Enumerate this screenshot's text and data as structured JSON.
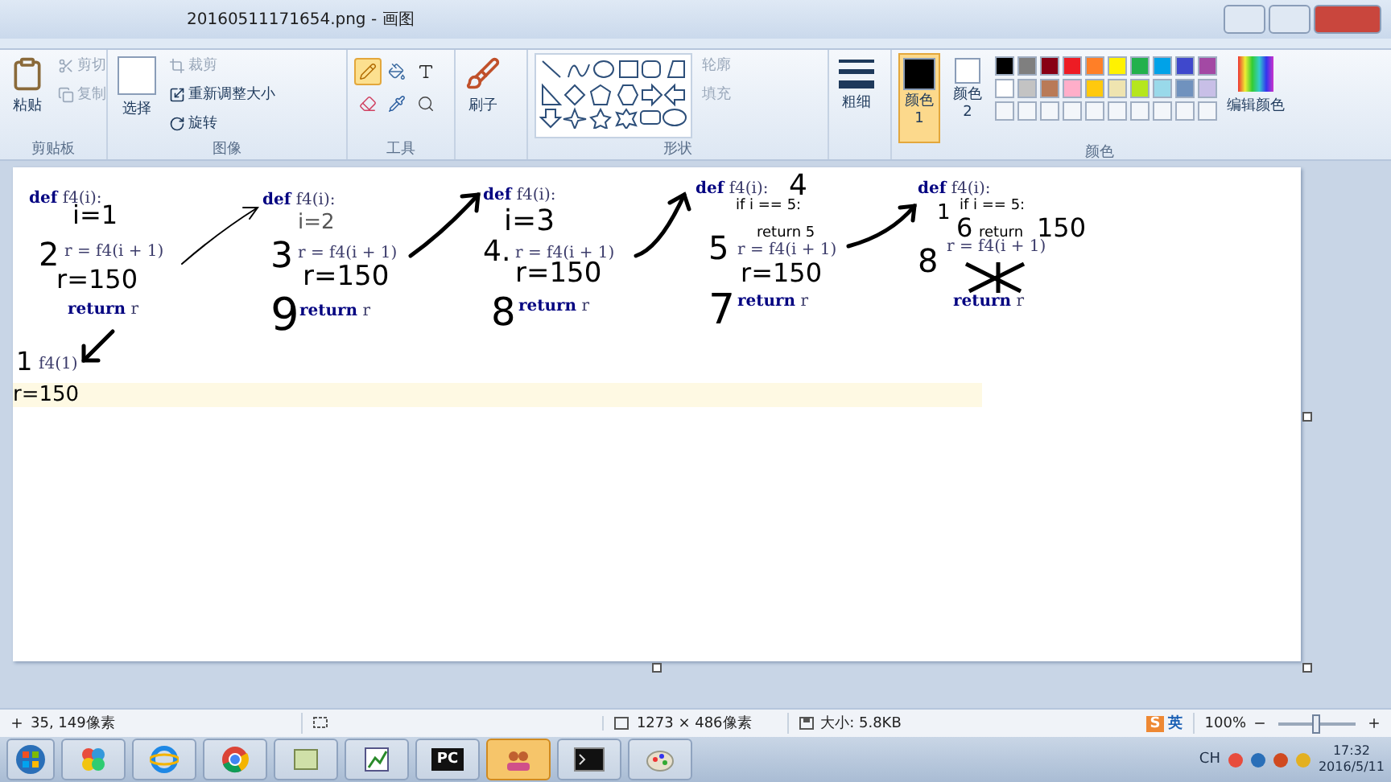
{
  "window": {
    "title": "20160511171654.png - 画图"
  },
  "clipboard": {
    "label": "剪贴板",
    "paste": "粘贴",
    "cut": {
      "label": "剪切",
      "disabled": true
    },
    "copy": {
      "label": "复制",
      "disabled": true
    }
  },
  "image": {
    "label": "图像",
    "select": "选择",
    "crop": {
      "label": "裁剪",
      "disabled": true
    },
    "resize": {
      "label": "重新调整大小",
      "disabled": false
    },
    "rotate": {
      "label": "旋转",
      "disabled": false
    }
  },
  "tools": {
    "label": "工具",
    "items": [
      {
        "kind": "pencil",
        "selected": true
      },
      {
        "kind": "fill",
        "selected": false
      },
      {
        "kind": "text",
        "selected": false
      },
      {
        "kind": "eraser",
        "selected": false
      },
      {
        "kind": "picker",
        "selected": false
      },
      {
        "kind": "magnifier",
        "selected": false
      }
    ]
  },
  "brushes": {
    "label": "刷子"
  },
  "shapes": {
    "label": "形状",
    "outline": "轮廓",
    "fill": "填充"
  },
  "size": {
    "label": "粗细"
  },
  "colors": {
    "label": "颜色",
    "slots": [
      {
        "label": "颜色 1",
        "color": "#000000",
        "selected": true
      },
      {
        "label": "颜色 2",
        "color": "#ffffff",
        "selected": false
      }
    ],
    "palette": [
      {
        "color": "#000000"
      },
      {
        "color": "#7f7f7f"
      },
      {
        "color": "#880015"
      },
      {
        "color": "#ed1c24"
      },
      {
        "color": "#ff7f27"
      },
      {
        "color": "#fff200"
      },
      {
        "color": "#22b14c"
      },
      {
        "color": "#00a2e8"
      },
      {
        "color": "#3f48cc"
      },
      {
        "color": "#a349a4"
      },
      {
        "color": "#ffffff"
      },
      {
        "color": "#c3c3c3"
      },
      {
        "color": "#b97a57"
      },
      {
        "color": "#ffaec9"
      },
      {
        "color": "#ffc90e"
      },
      {
        "color": "#efe4b0"
      },
      {
        "color": "#b5e61d"
      },
      {
        "color": "#99d9ea"
      },
      {
        "color": "#7092be"
      },
      {
        "color": "#c8bfe7"
      }
    ],
    "edit": "编辑颜色"
  },
  "canvas": {
    "items": [
      {
        "kind": "code",
        "text": "**def** f4(i):"
      },
      {
        "kind": "code",
        "text": "r = f4(i + 1)"
      },
      {
        "kind": "code",
        "text": "**return** r"
      },
      {
        "kind": "code",
        "text": "f4(1)"
      },
      {
        "kind": "code",
        "text": "**def** f4(i):"
      },
      {
        "kind": "code",
        "text": "r = f4(i + 1)"
      },
      {
        "kind": "code",
        "text": "**return** r"
      },
      {
        "kind": "code",
        "text": "**def** f4(i):"
      },
      {
        "kind": "code",
        "text": "r = f4(i + 1)"
      },
      {
        "kind": "code",
        "text": "**return** r"
      },
      {
        "kind": "code",
        "text": "**def** f4(i):"
      },
      {
        "kind": "typed",
        "text": "if i == 5:"
      },
      {
        "kind": "typed",
        "text": "return 5"
      },
      {
        "kind": "code",
        "text": "r = f4(i + 1)"
      },
      {
        "kind": "code",
        "text": "**return** r"
      },
      {
        "kind": "code",
        "text": "**def** f4(i):"
      },
      {
        "kind": "typed",
        "text": "if i == 5:"
      },
      {
        "kind": "typed",
        "text": "return"
      },
      {
        "kind": "code",
        "text": "r = f4(i + 1)"
      },
      {
        "kind": "code",
        "text": "**return** r"
      },
      {
        "kind": "hand",
        "text": "i=1"
      },
      {
        "kind": "hand",
        "text": "2"
      },
      {
        "kind": "hand",
        "text": "r=150"
      },
      {
        "kind": "hand",
        "text": "1"
      },
      {
        "kind": "hand",
        "text": "r=150"
      },
      {
        "kind": "thin",
        "text": "i=2"
      },
      {
        "kind": "hand",
        "text": "3"
      },
      {
        "kind": "hand",
        "text": "r=150"
      },
      {
        "kind": "hand",
        "text": "9"
      },
      {
        "kind": "hand",
        "text": "i=3"
      },
      {
        "kind": "hand",
        "text": "4."
      },
      {
        "kind": "hand",
        "text": "r=150"
      },
      {
        "kind": "hand",
        "text": "8"
      },
      {
        "kind": "hand",
        "text": "4"
      },
      {
        "kind": "hand",
        "text": "5"
      },
      {
        "kind": "hand",
        "text": "r=150"
      },
      {
        "kind": "hand",
        "text": "7"
      },
      {
        "kind": "hand",
        "text": "1"
      },
      {
        "kind": "hand",
        "text": "6"
      },
      {
        "kind": "hand",
        "text": "150"
      },
      {
        "kind": "hand",
        "text": "8"
      }
    ]
  },
  "status": {
    "cursor": "35, 149像素",
    "dimensions": "1273 × 486像素",
    "file_size": "大小: 5.8KB",
    "ime_logo": "S",
    "ime": "英",
    "zoom": {
      "reading": "100%",
      "level": 0.5
    }
  },
  "taskbar": {
    "apps": [
      {
        "kind": "orb",
        "active": false
      },
      {
        "kind": "tiles",
        "active": false
      },
      {
        "kind": "ie",
        "active": false
      },
      {
        "kind": "chrome",
        "active": false
      },
      {
        "kind": "notes",
        "active": false
      },
      {
        "kind": "chart",
        "active": false
      },
      {
        "kind": "pycharm",
        "label": "PC",
        "active": false
      },
      {
        "kind": "people",
        "active": true
      },
      {
        "kind": "console",
        "active": false
      },
      {
        "kind": "paint",
        "active": false
      }
    ],
    "lang": "CH",
    "time": "17:32",
    "date": "2016/5/11"
  }
}
